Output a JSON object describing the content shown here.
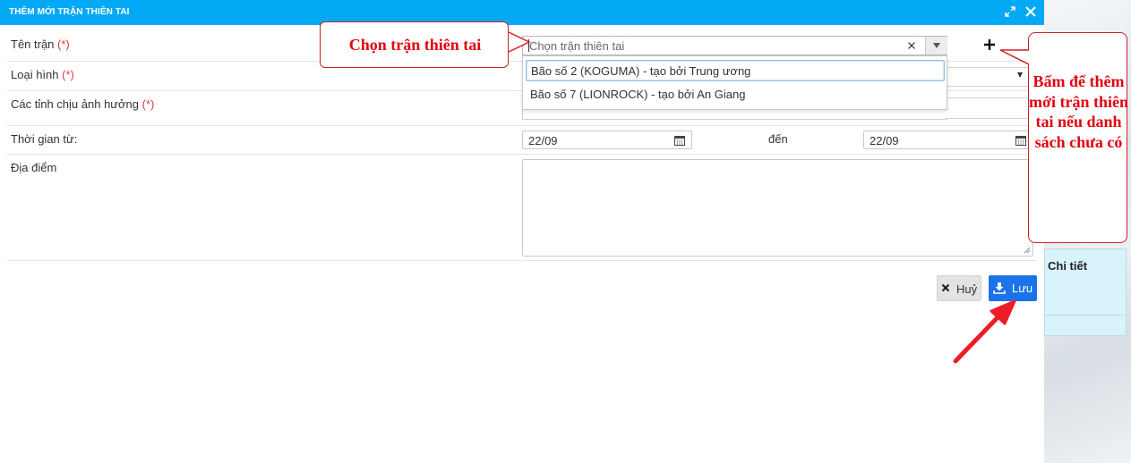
{
  "dialog": {
    "title": "THÊM MỚI TRẬN THIÊN TAI"
  },
  "form": {
    "ten_tran": {
      "label": "Tên trận",
      "required_mark": "(*)",
      "placeholder": "Chọn trận thiên tai"
    },
    "loai_hinh": {
      "label": "Loại hình",
      "required_mark": "(*)"
    },
    "cac_tinh": {
      "label": "Các tỉnh chịu ảnh hưởng",
      "required_mark": "(*)"
    },
    "thoi_gian": {
      "label": "Thời gian từ:",
      "from_value": "22/09",
      "to_label": "đến",
      "to_value": "22/09"
    },
    "dia_diem": {
      "label": "Địa điểm",
      "value": ""
    }
  },
  "dropdown": {
    "options": [
      "Bão số 2 (KOGUMA) - tạo bởi Trung ương",
      "Bão số 7 (LIONROCK) - tạo bởi An Giang"
    ],
    "highlighted_index": 0
  },
  "actions": {
    "cancel_label": "Huỷ",
    "save_label": "Lưu"
  },
  "background_panel": {
    "label": "Chi tiết"
  },
  "annotations": {
    "left_callout": "Chọn trận thiên tai",
    "right_callout": "Bấm để thêm mới trận thiên tai nếu danh sách chưa có"
  },
  "colors": {
    "header": "#03a9f4",
    "save_button": "#1a73e8",
    "annotation_red": "#e3000f",
    "required_red": "#e53935"
  },
  "icons": [
    "maximize-icon",
    "close-icon",
    "clear-icon",
    "chevron-down-icon",
    "plus-icon",
    "calendar-icon",
    "x-icon",
    "download-icon"
  ]
}
